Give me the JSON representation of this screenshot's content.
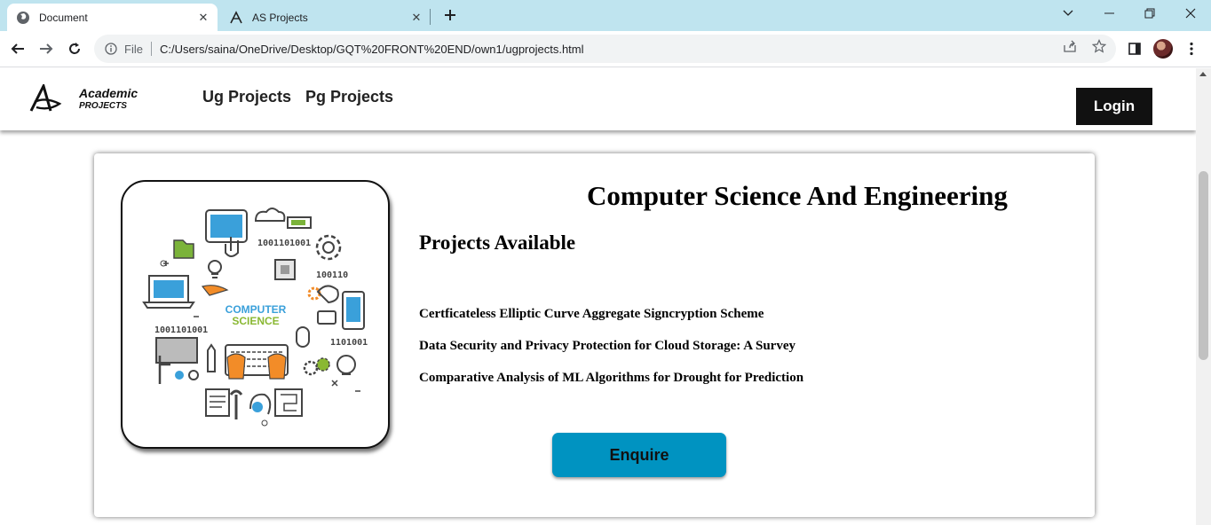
{
  "browser": {
    "tabs": [
      {
        "title": "Document",
        "icon": "globe-icon"
      },
      {
        "title": "AS Projects",
        "icon": "logo-favicon-icon"
      }
    ],
    "url_protocol": "File",
    "url": "C:/Users/saina/OneDrive/Desktop/GQT%20FRONT%20END/own1/ugprojects.html"
  },
  "site": {
    "logo_text_line1": "Academic",
    "logo_text_line2": "PROJECTS",
    "nav": [
      "Ug Projects",
      "Pg Projects"
    ],
    "login_label": "Login"
  },
  "card": {
    "title": "Computer Science And Engineering",
    "subtitle": "Projects Available",
    "projects": [
      "Certficateless Elliptic Curve Aggregate Signcryption Scheme",
      "Data Security and Privacy Protection for Cloud Storage: A Survey",
      "Comparative Analysis of ML Algorithms for Drought for Prediction"
    ],
    "enquire_label": "Enquire",
    "image_caption_line1": "COMPUTER",
    "image_caption_line2": "SCIENCE"
  },
  "colors": {
    "tabbar": "#bfe4ef",
    "enquire_button": "#0093c1",
    "login_button": "#111111"
  }
}
